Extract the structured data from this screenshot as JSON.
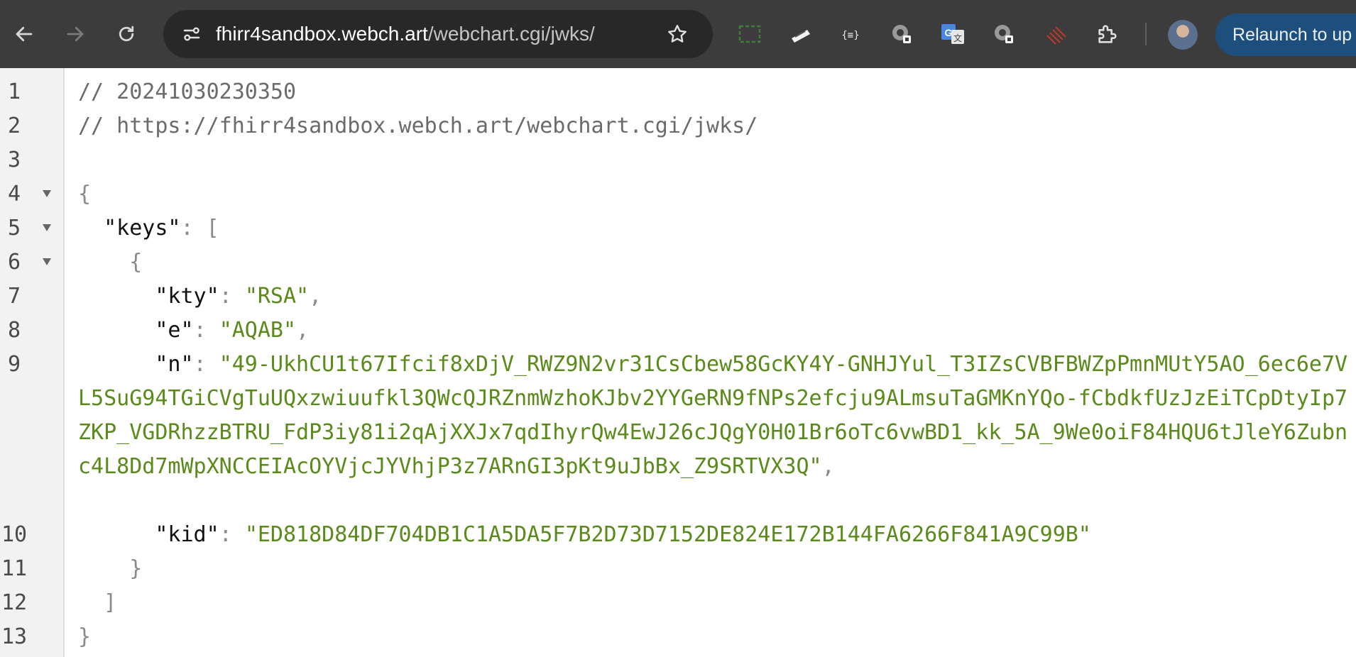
{
  "browser": {
    "url_host": "fhirr4sandbox.webch.art",
    "url_path": "/webchart.cgi/jwks/",
    "relaunch_label": "Relaunch to up"
  },
  "icons": [
    "back-arrow-icon",
    "forward-arrow-icon",
    "reload-icon",
    "site-info-icon",
    "bookmark-star-icon",
    "extension-icons",
    "puzzle-icon",
    "profile-avatar"
  ],
  "colors": {
    "toolbar": "#3c3c3c",
    "omnibox": "#282828",
    "relaunch": "#1e4e7c",
    "string": "#5a8a1a",
    "comment": "#6b6b6b"
  },
  "code": {
    "line_numbers": [
      "1",
      "2",
      "3",
      "4",
      "5",
      "6",
      "7",
      "8",
      "9",
      "10",
      "11",
      "12",
      "13"
    ],
    "comment1": "// 20241030230350",
    "comment2": "// https://fhirr4sandbox.webch.art/webchart.cgi/jwks/",
    "open_brace": "{",
    "keys_key": "\"keys\"",
    "colon": ":",
    "open_bracket": "[",
    "inner_open": "{",
    "kty_key": "\"kty\"",
    "kty_val": "\"RSA\"",
    "e_key": "\"e\"",
    "e_val": "\"AQAB\"",
    "n_key": "\"n\"",
    "n_val": "\"49-UkhCU1t67Ifcif8xDjV_RWZ9N2vr31CsCbew58GcKY4Y-GNHJYul_T3IZsCVBFBWZpPmnMUtY5AO_6ec6e7VL5SuG94TGiCVgTuUQxzwiuufkl3QWcQJRZnmWzhoKJbv2YYGeRN9fNPs2efcju9ALmsuTaGMKnYQo-fCbdkfUzJzEiTCpDtyIp7ZKP_VGDRhzzBTRU_FdP3iy81i2qAjXXJx7qdIhyrQw4EwJ26cJQgY0H01Br6oTc6vwBD1_kk_5A_9We0oiF84HQU6tJleY6Zubnc4L8Dd7mWpXNCCEIAcOYVjcJYVhjP3z7ARnGI3pKt9uJbBx_Z9SRTVX3Q\"",
    "kid_key": "\"kid\"",
    "kid_val": "\"ED818D84DF704DB1C1A5DA5F7B2D73D7152DE824E172B144FA6266F841A9C99B\"",
    "inner_close": "}",
    "close_bracket": "]",
    "close_brace": "}",
    "comma": ","
  }
}
